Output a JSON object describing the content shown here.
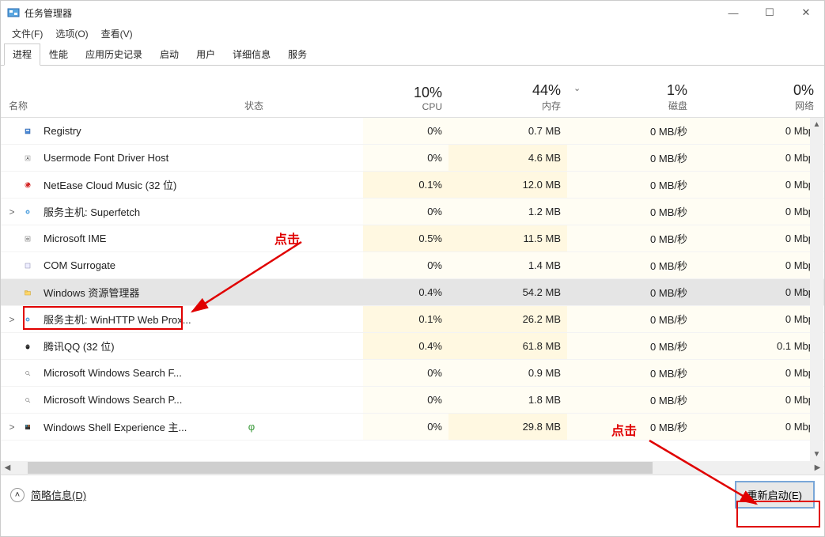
{
  "window": {
    "title": "任务管理器"
  },
  "menu": {
    "file": "文件(F)",
    "options": "选项(O)",
    "view": "查看(V)"
  },
  "tabs": [
    "进程",
    "性能",
    "应用历史记录",
    "启动",
    "用户",
    "详细信息",
    "服务"
  ],
  "active_tab": 0,
  "columns": {
    "name": "名称",
    "status": "状态",
    "cpu": {
      "pct": "10%",
      "label": "CPU"
    },
    "mem": {
      "pct": "44%",
      "label": "内存"
    },
    "disk": {
      "pct": "1%",
      "label": "磁盘"
    },
    "net": {
      "pct": "0%",
      "label": "网络"
    }
  },
  "processes": [
    {
      "expand": "",
      "icon": "reg",
      "name": "Registry",
      "cpu": "0%",
      "mem": "0.7 MB",
      "disk": "0 MB/秒",
      "net": "0 Mbp",
      "cpu_t": 0,
      "mem_t": 0
    },
    {
      "expand": "",
      "icon": "font",
      "name": "Usermode Font Driver Host",
      "cpu": "0%",
      "mem": "4.6 MB",
      "disk": "0 MB/秒",
      "net": "0 Mbp",
      "cpu_t": 0,
      "mem_t": 1
    },
    {
      "expand": "",
      "icon": "nem",
      "name": "NetEase Cloud Music (32 位)",
      "cpu": "0.1%",
      "mem": "12.0 MB",
      "disk": "0 MB/秒",
      "net": "0 Mbp",
      "cpu_t": 1,
      "mem_t": 1
    },
    {
      "expand": ">",
      "icon": "gear",
      "name": "服务主机: Superfetch",
      "cpu": "0%",
      "mem": "1.2 MB",
      "disk": "0 MB/秒",
      "net": "0 Mbp",
      "cpu_t": 0,
      "mem_t": 0
    },
    {
      "expand": "",
      "icon": "ime",
      "name": "Microsoft IME",
      "cpu": "0.5%",
      "mem": "11.5 MB",
      "disk": "0 MB/秒",
      "net": "0 Mbp",
      "cpu_t": 1,
      "mem_t": 1
    },
    {
      "expand": "",
      "icon": "app",
      "name": "COM Surrogate",
      "cpu": "0%",
      "mem": "1.4 MB",
      "disk": "0 MB/秒",
      "net": "0 Mbp",
      "cpu_t": 0,
      "mem_t": 0
    },
    {
      "expand": "",
      "icon": "exp",
      "name": "Windows 资源管理器",
      "cpu": "0.4%",
      "mem": "54.2 MB",
      "disk": "0 MB/秒",
      "net": "0 Mbp",
      "selected": true,
      "cpu_t": 0,
      "mem_t": 0
    },
    {
      "expand": ">",
      "icon": "gear",
      "name": "服务主机: WinHTTP Web Prox...",
      "cpu": "0.1%",
      "mem": "26.2 MB",
      "disk": "0 MB/秒",
      "net": "0 Mbp",
      "cpu_t": 1,
      "mem_t": 1
    },
    {
      "expand": "",
      "icon": "qq",
      "name": "腾讯QQ (32 位)",
      "cpu": "0.4%",
      "mem": "61.8 MB",
      "disk": "0 MB/秒",
      "net": "0.1 Mbp",
      "cpu_t": 1,
      "mem_t": 1
    },
    {
      "expand": "",
      "icon": "srch",
      "name": "Microsoft Windows Search F...",
      "cpu": "0%",
      "mem": "0.9 MB",
      "disk": "0 MB/秒",
      "net": "0 Mbp",
      "cpu_t": 0,
      "mem_t": 0
    },
    {
      "expand": "",
      "icon": "srch",
      "name": "Microsoft Windows Search P...",
      "cpu": "0%",
      "mem": "1.8 MB",
      "disk": "0 MB/秒",
      "net": "0 Mbp",
      "cpu_t": 0,
      "mem_t": 0
    },
    {
      "expand": ">",
      "icon": "shell",
      "name": "Windows Shell Experience 主...",
      "cpu": "0%",
      "mem": "29.8 MB",
      "disk": "0 MB/秒",
      "net": "0 Mbp",
      "leaf": true,
      "cpu_t": 0,
      "mem_t": 1
    }
  ],
  "footer": {
    "brief": "简略信息(D)",
    "action": "重新启动(E)"
  },
  "annotations": {
    "click1": "点击",
    "click2": "点击"
  }
}
